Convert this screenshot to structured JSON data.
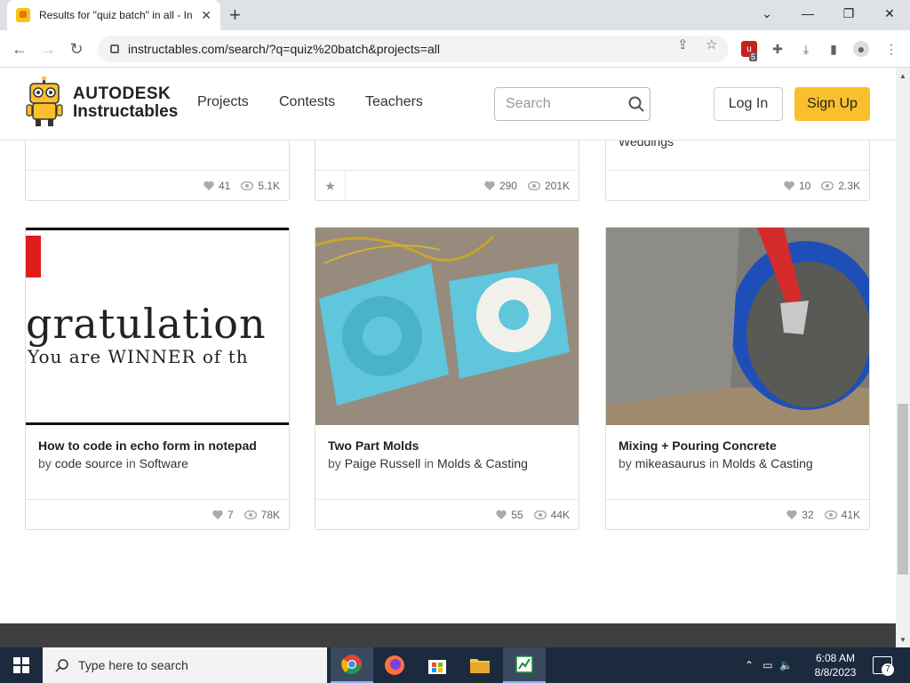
{
  "browser": {
    "tab_title": "Results for \"quiz batch\" in all - In",
    "url": "instructables.com/search/?q=quiz%20batch&projects=all",
    "extension_badge": "5"
  },
  "site": {
    "logo_line1": "AUTODESK",
    "logo_line2": "Instructables",
    "nav": [
      "Projects",
      "Contests",
      "Teachers"
    ],
    "search_placeholder": "Search",
    "login_label": "Log In",
    "signup_label": "Sign Up",
    "accent_color": "#fabf2c"
  },
  "top_cards": [
    {
      "category": "",
      "likes": "41",
      "views": "5.1K"
    },
    {
      "category": "",
      "likes": "290",
      "views": "201K"
    },
    {
      "category": "Weddings",
      "likes": "10",
      "views": "2.3K"
    }
  ],
  "cards": [
    {
      "title": "How to code in echo form in notepad",
      "by": "by",
      "author": "code source",
      "in": "in",
      "category": "Software",
      "likes": "7",
      "views": "78K",
      "thumb_text1": "gratulation",
      "thumb_text2": "You are WINNER of th"
    },
    {
      "title": "Two Part Molds",
      "by": "by",
      "author": "Paige Russell",
      "in": "in",
      "category": "Molds & Casting",
      "likes": "55",
      "views": "44K"
    },
    {
      "title": "Mixing + Pouring Concrete",
      "by": "by",
      "author": "mikeasaurus",
      "in": "in",
      "category": "Molds & Casting",
      "likes": "32",
      "views": "41K"
    }
  ],
  "taskbar": {
    "search_placeholder": "Type here to search",
    "time": "6:08 AM",
    "date": "8/8/2023",
    "notification_count": "7"
  }
}
